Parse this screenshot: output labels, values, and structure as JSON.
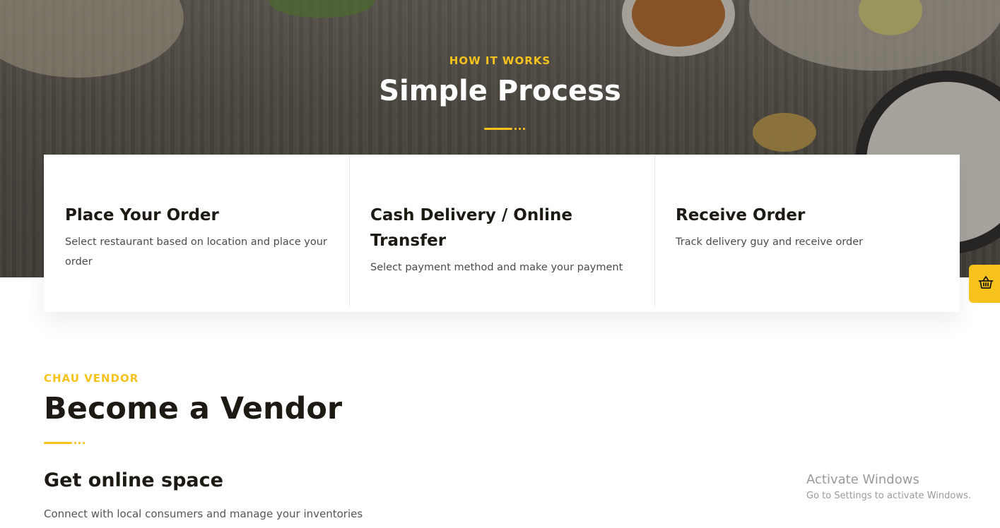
{
  "hero": {
    "eyebrow": "HOW IT WORKS",
    "title": "Simple Process"
  },
  "steps": [
    {
      "title": "Place Your Order",
      "description": "Select restaurant based on location and place your order"
    },
    {
      "title": "Cash Delivery / Online Transfer",
      "description": "Select payment method and make your payment"
    },
    {
      "title": "Receive Order",
      "description": "Track delivery guy and receive order"
    }
  ],
  "vendor": {
    "eyebrow": "CHAU VENDOR",
    "title": "Become a Vendor",
    "subheading": "Get online space",
    "description": "Connect with local consumers and manage your inventories"
  },
  "cart_button": {
    "icon": "basket-icon"
  },
  "windows_watermark": {
    "line1": "Activate Windows",
    "line2": "Go to Settings to activate Windows."
  },
  "colors": {
    "accent": "#f7c21b",
    "heading": "#1d1a14",
    "body_text": "#4b4b4b"
  }
}
